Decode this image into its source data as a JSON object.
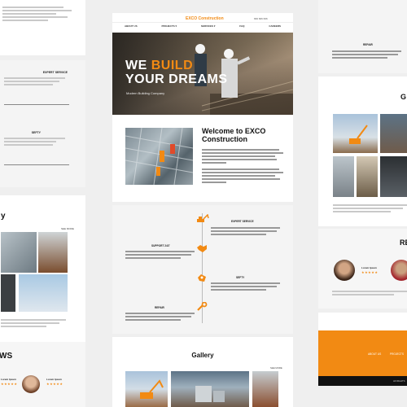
{
  "brand": {
    "name": "EXCO Construction",
    "accent": "#f28a13"
  },
  "nav": {
    "items": [
      "ABOUT US",
      "PROJECTS ▾",
      "SERVICES ▾",
      "FAQ",
      "CAREERS"
    ],
    "phone": "666 666 666"
  },
  "hero": {
    "line1_a": "WE",
    "line1_b": "BUILD",
    "line2": "YOUR DREAMS",
    "sub": "Modern Building Company"
  },
  "welcome": {
    "title_line1": "Welcome to EXCO",
    "title_line2": "Construction"
  },
  "services": [
    {
      "title": "EXPERT SERVICE",
      "icon": "excavator-icon"
    },
    {
      "title": "SUPPORT 24/7",
      "icon": "handshake-icon"
    },
    {
      "title": "SEFTY",
      "icon": "safety-hand-icon"
    },
    {
      "title": "REPAIR",
      "icon": "wrench-icon"
    }
  ],
  "gallery": {
    "title": "Gallery",
    "more": "SEE MORE"
  },
  "left": {
    "services": [
      "EXPERT SERVICE",
      "SEFTY"
    ],
    "gallery_title_fragment": "y",
    "gallery_more": "SEE MORE",
    "reviews_title_fragment": "WS",
    "reviewers": [
      "Lorem Ipsum",
      "Lorem Ipsum"
    ]
  },
  "right": {
    "repair_title": "REPAIR",
    "gallery_title_fragment": "G",
    "reviews_title_fragment": "RE",
    "reviewers": [
      "Lorem Ipsum",
      "Lorem"
    ],
    "footer_links": [
      "ABOUT US",
      "PROJECTS"
    ],
    "copyright": "All RIGHTS"
  }
}
